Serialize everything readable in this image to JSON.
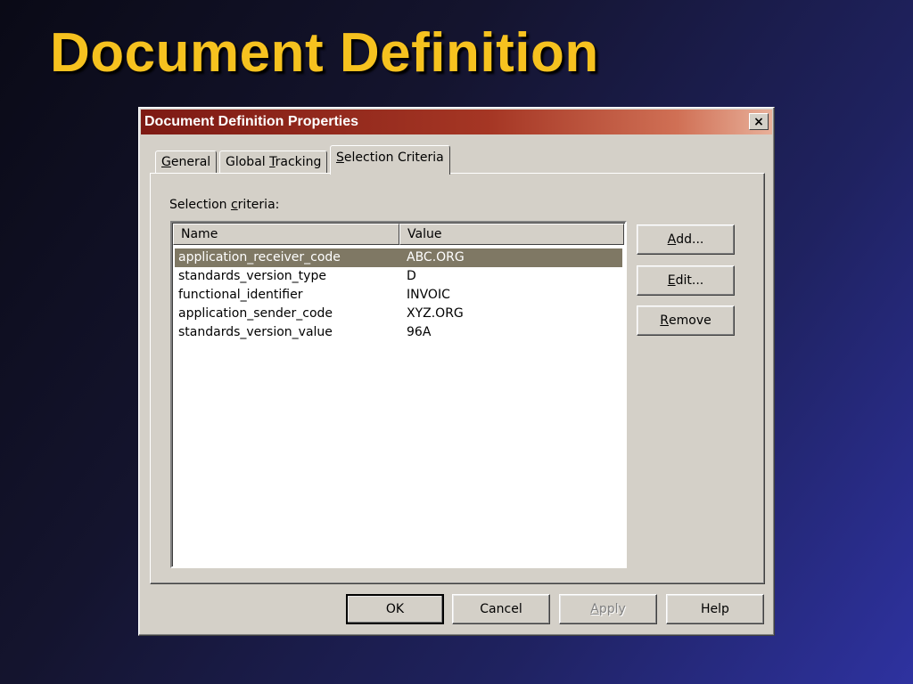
{
  "slide": {
    "title": "Document Definition"
  },
  "dialog": {
    "title": "Document Definition Properties",
    "close_label": "×",
    "tabs": [
      {
        "pre": "",
        "key": "G",
        "post": "eneral"
      },
      {
        "pre": "Global ",
        "key": "T",
        "post": "racking"
      },
      {
        "pre": "",
        "key": "S",
        "post": "election Criteria"
      }
    ],
    "active_tab": "Selection Criteria",
    "section": {
      "pre": "Selection ",
      "key": "c",
      "post": "riteria:"
    },
    "list": {
      "columns": [
        "Name",
        "Value"
      ],
      "rows": [
        {
          "name": "application_receiver_code",
          "value": "ABC.ORG"
        },
        {
          "name": "standards_version_type",
          "value": "D"
        },
        {
          "name": "functional_identifier",
          "value": "INVOIC"
        },
        {
          "name": "application_sender_code",
          "value": "XYZ.ORG"
        },
        {
          "name": "standards_version_value",
          "value": "96A"
        }
      ],
      "selected_row": "application_receiver_code"
    },
    "side_buttons": {
      "add": {
        "key": "A",
        "post": "dd..."
      },
      "edit": {
        "key": "E",
        "post": "dit..."
      },
      "remove": {
        "key": "R",
        "post": "emove"
      }
    },
    "footer_buttons": {
      "ok": "OK",
      "cancel": "Cancel",
      "apply": {
        "key": "A",
        "post": "pply"
      },
      "help": "Help"
    }
  }
}
